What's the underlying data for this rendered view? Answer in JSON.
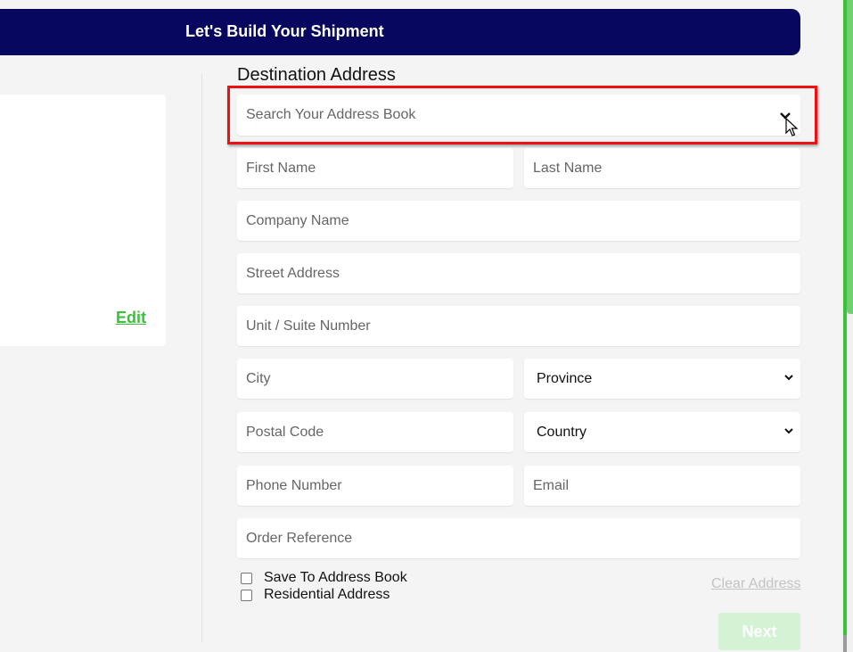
{
  "header": {
    "title": "Let's Build Your Shipment"
  },
  "left_panel": {
    "edit_label": "Edit"
  },
  "destination": {
    "title": "Destination Address",
    "search": {
      "placeholder": "Search Your Address Book"
    },
    "first_name": {
      "placeholder": "First Name"
    },
    "last_name": {
      "placeholder": "Last Name"
    },
    "company": {
      "placeholder": "Company Name"
    },
    "street": {
      "placeholder": "Street Address"
    },
    "unit": {
      "placeholder": "Unit / Suite Number"
    },
    "city": {
      "placeholder": "City"
    },
    "province": {
      "selected": "Province"
    },
    "postal": {
      "placeholder": "Postal Code"
    },
    "country": {
      "selected": "Country"
    },
    "phone": {
      "placeholder": "Phone Number"
    },
    "email": {
      "placeholder": "Email"
    },
    "reference": {
      "placeholder": "Order Reference"
    },
    "save_checkbox_label": "Save To Address Book",
    "residential_checkbox_label": "Residential Address",
    "clear_label": "Clear Address",
    "next_label": "Next"
  },
  "colors": {
    "header": "#07075f",
    "accent": "#3cc13b",
    "highlight": "#e11111"
  }
}
